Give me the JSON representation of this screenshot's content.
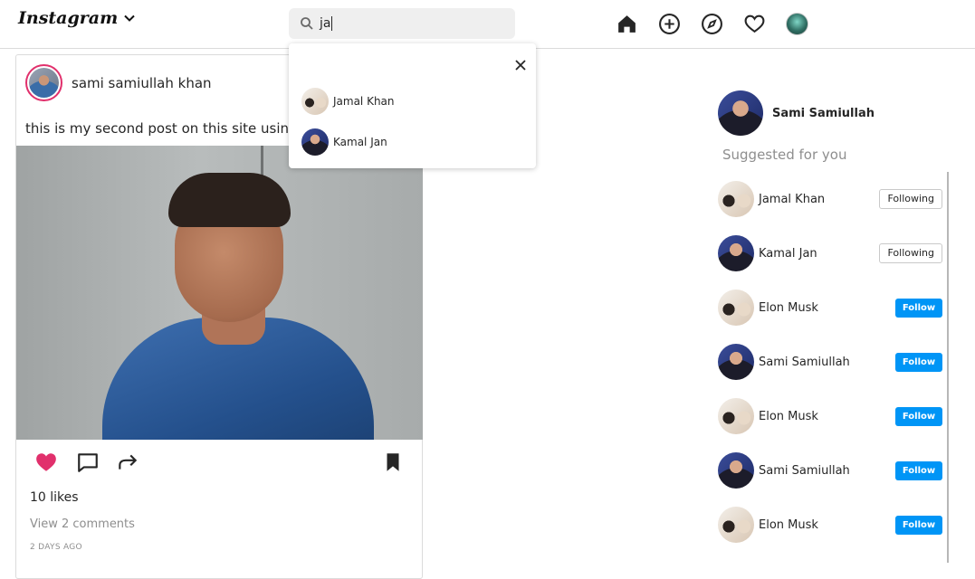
{
  "header": {
    "logo": "Instagram",
    "search": {
      "query": "ja"
    },
    "nav_icons": [
      "home-icon",
      "add-post-icon",
      "explore-icon",
      "heart-icon",
      "profile-avatar"
    ]
  },
  "search_results": [
    {
      "name": "Jamal Khan",
      "avatar": "couple"
    },
    {
      "name": "Kamal Jan",
      "avatar": "man-suit"
    }
  ],
  "post": {
    "username": "sami samiullah khan",
    "caption": "this is my second post on this site using fi",
    "likes": "10 likes",
    "comments_link": "View 2 comments",
    "time": "2 DAYS AGO",
    "liked": true
  },
  "sidebar": {
    "current_user": "Sami Samiullah",
    "suggested_title": "Suggested for you",
    "suggestions": [
      {
        "name": "Jamal Khan",
        "button": "Following",
        "status": "following"
      },
      {
        "name": "Kamal Jan",
        "button": "Following",
        "status": "following"
      },
      {
        "name": "Elon Musk",
        "button": "Follow",
        "status": "follow"
      },
      {
        "name": "Sami Samiullah",
        "button": "Follow",
        "status": "follow"
      },
      {
        "name": "Elon Musk",
        "button": "Follow",
        "status": "follow"
      },
      {
        "name": "Sami Samiullah",
        "button": "Follow",
        "status": "follow"
      },
      {
        "name": "Elon Musk",
        "button": "Follow",
        "status": "follow"
      }
    ]
  },
  "colors": {
    "like": "#e1306c",
    "follow_button": "#0095f6",
    "border": "#dbdbdb",
    "muted": "#8e8e8e"
  }
}
